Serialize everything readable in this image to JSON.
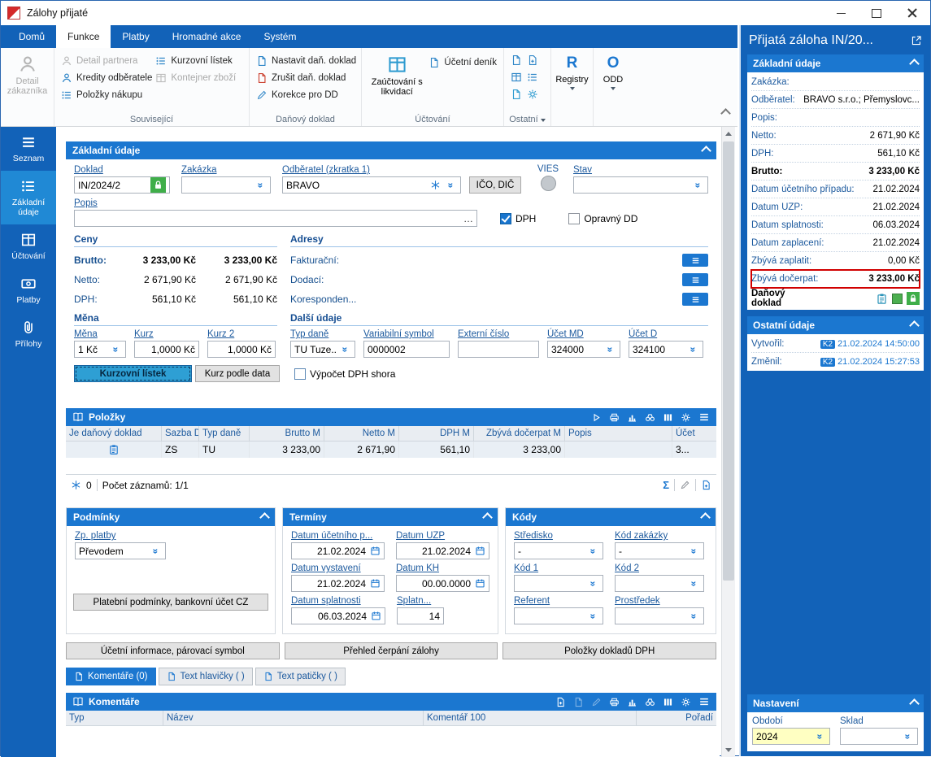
{
  "icons": {
    "dropdown": "»",
    "ellipsis": "…",
    "sum": "Σ"
  },
  "window": {
    "title": "Zálohy přijaté"
  },
  "ribbon": {
    "tabs": [
      {
        "label": "Domů"
      },
      {
        "label": "Funkce"
      },
      {
        "label": "Platby"
      },
      {
        "label": "Hromadné akce"
      },
      {
        "label": "Systém"
      }
    ],
    "active_tab": "Funkce",
    "detail_customer": "Detail zákazníka",
    "groups": {
      "souvisejici": {
        "label": "Související",
        "items": [
          "Detail partnera",
          "Kredity odběratele",
          "Položky nákupu",
          "Kurzovní lístek",
          "Kontejner zboží"
        ]
      },
      "danovy": {
        "label": "Daňový doklad",
        "items": [
          "Nastavit daň. doklad",
          "Zrušit daň. doklad",
          "Korekce pro DD"
        ]
      },
      "uctovani": {
        "label": "Účtování",
        "big_item": "Zaúčtování s likvidací",
        "item": "Účetní deník"
      },
      "ostatni": {
        "label": "Ostatní"
      },
      "registry": {
        "label": "Registry",
        "letter": "R"
      },
      "odd": {
        "label": "ODD",
        "letter": "O"
      }
    }
  },
  "sidebar": {
    "items": [
      {
        "label": "Seznam"
      },
      {
        "label": "Základní údaje"
      },
      {
        "label": "Účtování"
      },
      {
        "label": "Platby"
      },
      {
        "label": "Přílohy"
      }
    ],
    "active": "Základní údaje"
  },
  "basic": {
    "title": "Základní údaje",
    "doklad": {
      "label": "Doklad",
      "value": "IN/2024/2"
    },
    "zakazka": {
      "label": "Zakázka",
      "value": ""
    },
    "odberatel": {
      "label": "Odběratel (zkratka 1)",
      "value": "BRAVO"
    },
    "ico_dic": "IČO, DIČ",
    "vies": "VIES",
    "stav": {
      "label": "Stav",
      "value": ""
    },
    "popis": {
      "label": "Popis",
      "value": ""
    },
    "dph_checkbox": "DPH",
    "opravny_dd_checkbox": "Opravný DD",
    "ceny": {
      "title": "Ceny",
      "rows": [
        {
          "label": "Brutto:",
          "v1": "3 233,00 Kč",
          "v2": "3 233,00 Kč"
        },
        {
          "label": "Netto:",
          "v1": "2 671,90 Kč",
          "v2": "2 671,90 Kč"
        },
        {
          "label": "DPH:",
          "v1": "561,10 Kč",
          "v2": "561,10 Kč"
        }
      ]
    },
    "adresy": {
      "title": "Adresy",
      "rows": [
        {
          "label": "Fakturační:"
        },
        {
          "label": "Dodací:"
        },
        {
          "label": "Koresponden..."
        }
      ]
    },
    "mena": {
      "title": "Měna",
      "mena": {
        "label": "Měna",
        "value": "1 Kč"
      },
      "kurz": {
        "label": "Kurz",
        "value": "1,0000 Kč"
      },
      "kurz2": {
        "label": "Kurz 2",
        "value": "1,0000 Kč"
      }
    },
    "dalsi": {
      "title": "Další údaje",
      "typ_dane": {
        "label": "Typ daně",
        "value": "TU Tuze..."
      },
      "var_symbol": {
        "label": "Variabilní symbol",
        "value": "0000002"
      },
      "externi": {
        "label": "Externí číslo",
        "value": ""
      },
      "ucet_md": {
        "label": "Účet MD",
        "value": "324000"
      },
      "ucet_d": {
        "label": "Účet D",
        "value": "324100"
      }
    },
    "kurzovni_listek_btn": "Kurzovní lístek",
    "kurz_podle_data_btn": "Kurz podle data",
    "vypocet_dph_checkbox": "Výpočet DPH shora"
  },
  "polozky": {
    "title": "Položky",
    "columns": [
      "Je daňový doklad",
      "Sazba D",
      "Typ daně",
      "Brutto M",
      "Netto M",
      "DPH M",
      "Zbývá dočerpat M",
      "Popis",
      "Účet"
    ],
    "row": {
      "sazba": "ZS",
      "typ_dane": "TU",
      "brutto": "3 233,00",
      "netto": "2 671,90",
      "dph": "561,10",
      "zbyva": "3 233,00",
      "popis": "",
      "ucet": "3..."
    },
    "footer": {
      "freeze_count": "0",
      "records": "Počet záznamů: 1/1"
    }
  },
  "podminky": {
    "title": "Podmínky",
    "zp_platby": {
      "label": "Zp. platby",
      "value": "Převodem"
    },
    "button": "Platební podmínky, bankovní účet CZ"
  },
  "terminy": {
    "title": "Termíny",
    "fields": [
      {
        "label": "Datum účetního p...",
        "value": "21.02.2024"
      },
      {
        "label": "Datum UZP",
        "value": "21.02.2024"
      },
      {
        "label": "Datum vystavení",
        "value": "21.02.2024"
      },
      {
        "label": "Datum KH",
        "value": "00.00.0000"
      },
      {
        "label": "Datum splatnosti",
        "value": "06.03.2024"
      },
      {
        "label": "Splatn...",
        "value": "14"
      }
    ]
  },
  "kody": {
    "title": "Kódy",
    "fields": [
      {
        "label": "Středisko",
        "value": "-"
      },
      {
        "label": "Kód zakázky",
        "value": "-"
      },
      {
        "label": "Kód 1",
        "value": ""
      },
      {
        "label": "Kód 2",
        "value": ""
      },
      {
        "label": "Referent",
        "value": ""
      },
      {
        "label": "Prostředek",
        "value": ""
      }
    ]
  },
  "bottom_buttons": [
    "Účetní informace, párovací symbol",
    "Přehled čerpání zálohy",
    "Položky dokladů DPH"
  ],
  "comment_tabs": [
    {
      "label": "Komentáře (0)"
    },
    {
      "label": "Text hlavičky ( )"
    },
    {
      "label": "Text patičky ( )"
    }
  ],
  "komentare": {
    "title": "Komentáře",
    "columns": [
      "Typ",
      "Název",
      "Komentář 100",
      "Pořadí"
    ]
  },
  "right_panel": {
    "title": "Přijatá záloha IN/20...",
    "zakladni": {
      "title": "Základní údaje",
      "rows": [
        {
          "label": "Zakázka:",
          "value": ""
        },
        {
          "label": "Odběratel:",
          "value": "BRAVO s.r.o.; Přemyslovc..."
        },
        {
          "label": "Popis:",
          "value": ""
        },
        {
          "label": "Netto:",
          "value": "2 671,90 Kč"
        },
        {
          "label": "DPH:",
          "value": "561,10 Kč"
        },
        {
          "label": "Brutto:",
          "value": "3 233,00 Kč"
        },
        {
          "label": "Datum účetního případu:",
          "value": "21.02.2024"
        },
        {
          "label": "Datum UZP:",
          "value": "21.02.2024"
        },
        {
          "label": "Datum splatnosti:",
          "value": "06.03.2024"
        },
        {
          "label": "Datum zaplacení:",
          "value": "21.02.2024"
        },
        {
          "label": "Zbývá zaplatit:",
          "value": "0,00 Kč"
        },
        {
          "label": "Zbývá dočerpat:",
          "value": "3 233,00 Kč"
        },
        {
          "label": "Daňový doklad",
          "value": ""
        }
      ]
    },
    "ostatni": {
      "title": "Ostatní údaje",
      "rows": [
        {
          "label": "Vytvořil:",
          "badge": "K2",
          "value": "21.02.2024 14:50:00"
        },
        {
          "label": "Změnil:",
          "badge": "K2",
          "value": "21.02.2024 15:27:53"
        }
      ]
    },
    "nastaveni": {
      "title": "Nastavení",
      "obdobi": {
        "label": "Období",
        "value": "2024"
      },
      "sklad": {
        "label": "Sklad",
        "value": ""
      }
    }
  }
}
